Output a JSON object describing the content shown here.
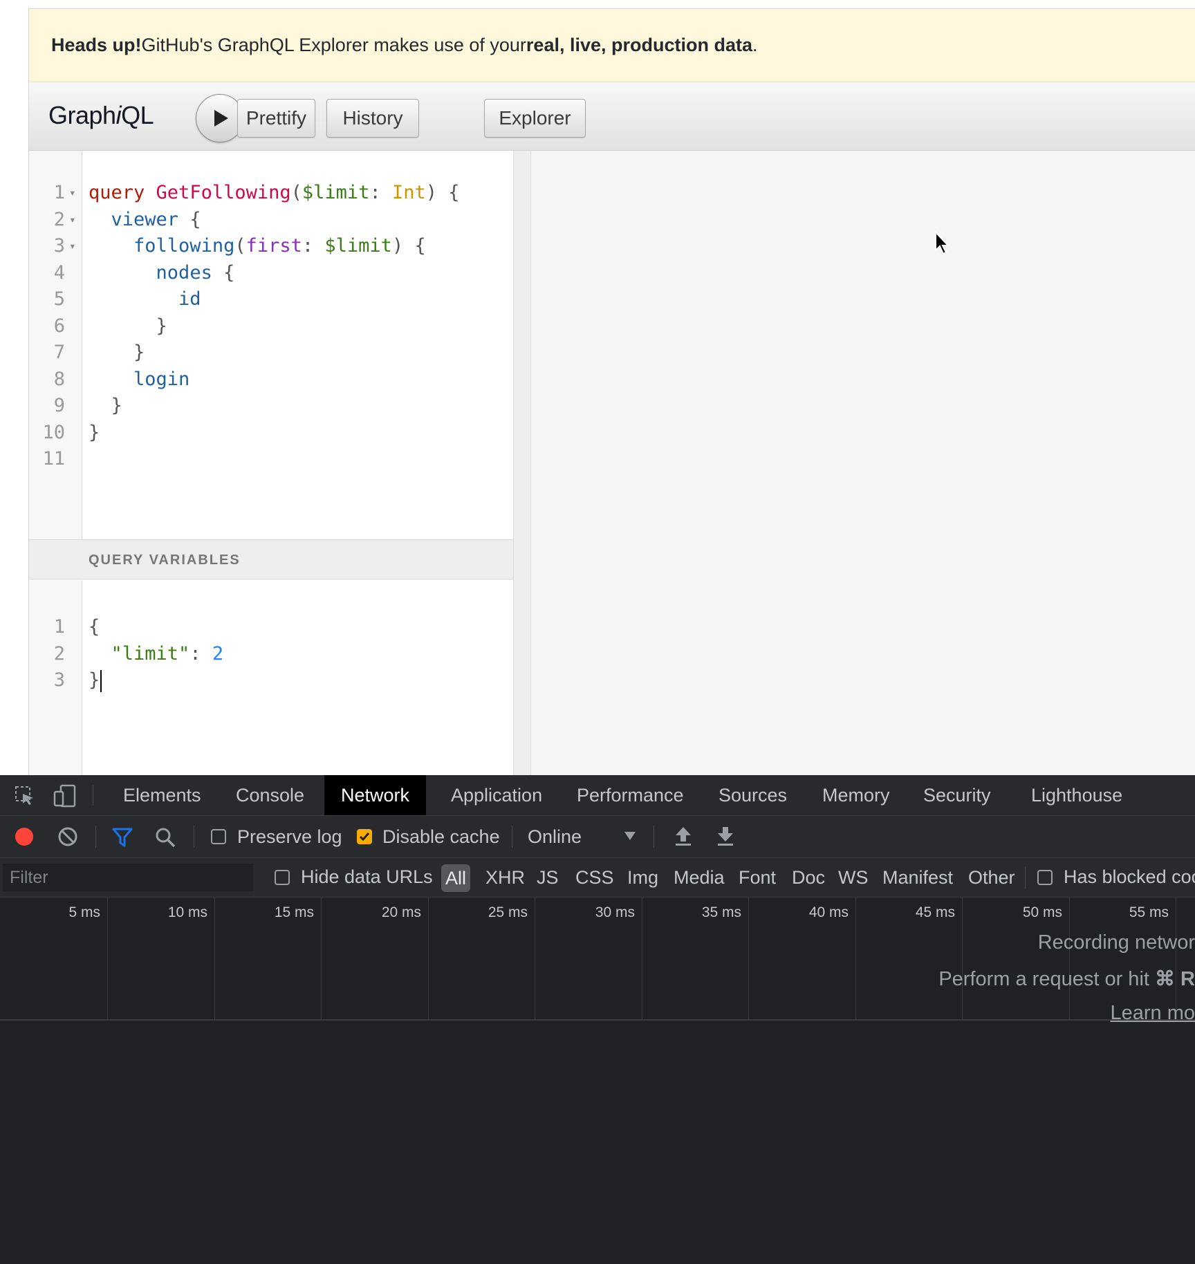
{
  "banner": {
    "strong_lead": "Heads up!",
    "text_before": " GitHub's GraphQL Explorer makes use of your ",
    "strong_tail": "real, live, production data",
    "text_after": "."
  },
  "toolbar": {
    "title_prefix": "Graph",
    "title_italic": "i",
    "title_suffix": "QL",
    "run_icon": "play-icon",
    "prettify_label": "Prettify",
    "history_label": "History",
    "explorer_label": "Explorer"
  },
  "query_editor": {
    "line_numbers": [
      "1",
      "2",
      "3",
      "4",
      "5",
      "6",
      "7",
      "8",
      "9",
      "10",
      "11"
    ],
    "folded_lines": [
      "1",
      "2",
      "3"
    ],
    "lines": [
      "query GetFollowing($limit: Int) {",
      "  viewer {",
      "    following(first: $limit) {",
      "      nodes {",
      "        id",
      "      }",
      "    }",
      "    login",
      "  }",
      "}",
      ""
    ]
  },
  "variables": {
    "header": "QUERY VARIABLES",
    "line_numbers": [
      "1",
      "2",
      "3"
    ],
    "lines": [
      "{",
      "  \"limit\": 2",
      "}"
    ]
  },
  "devtools": {
    "tabs": [
      "Elements",
      "Console",
      "Network",
      "Application",
      "Performance",
      "Sources",
      "Memory",
      "Security",
      "Lighthouse"
    ],
    "active_tab": "Network",
    "toolbar": {
      "preserve_log": "Preserve log",
      "preserve_log_checked": false,
      "disable_cache": "Disable cache",
      "disable_cache_checked": true,
      "throttling": "Online"
    },
    "filter": {
      "placeholder": "Filter",
      "hide_data_urls": "Hide data URLs",
      "types": [
        "All",
        "XHR",
        "JS",
        "CSS",
        "Img",
        "Media",
        "Font",
        "Doc",
        "WS",
        "Manifest",
        "Other"
      ],
      "active_type": "All",
      "has_blocked": "Has blocked coo"
    },
    "timeline_ticks": [
      "5 ms",
      "10 ms",
      "15 ms",
      "20 ms",
      "25 ms",
      "30 ms",
      "35 ms",
      "40 ms",
      "45 ms",
      "50 ms",
      "55 ms"
    ],
    "empty_state": {
      "line1": "Recording networ",
      "line2_prefix": "Perform a request or hit ",
      "line2_key": "⌘ R",
      "link": "Learn mo"
    },
    "colors": {
      "record": "#ff453a",
      "filter_icon": "#1a73e8",
      "checkbox_checked": "#f9ab00"
    }
  }
}
